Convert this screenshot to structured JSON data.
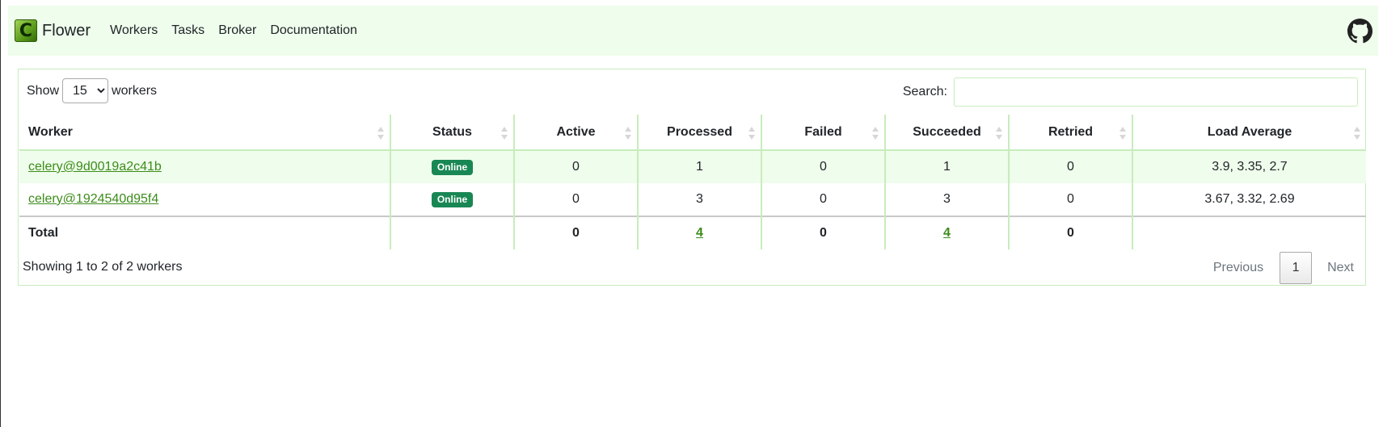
{
  "navbar": {
    "brand": "Flower",
    "links": [
      "Workers",
      "Tasks",
      "Broker",
      "Documentation"
    ]
  },
  "controls": {
    "show_label": "Show",
    "page_size": "15",
    "workers_label": "workers",
    "search_label": "Search:"
  },
  "table": {
    "headers": [
      "Worker",
      "Status",
      "Active",
      "Processed",
      "Failed",
      "Succeeded",
      "Retried",
      "Load Average"
    ],
    "rows": [
      {
        "worker": "celery@9d0019a2c41b",
        "status": "Online",
        "active": "0",
        "processed": "1",
        "failed": "0",
        "succeeded": "1",
        "retried": "0",
        "load": "3.9, 3.35, 2.7"
      },
      {
        "worker": "celery@1924540d95f4",
        "status": "Online",
        "active": "0",
        "processed": "3",
        "failed": "0",
        "succeeded": "3",
        "retried": "0",
        "load": "3.67, 3.32, 2.69"
      }
    ],
    "total": {
      "label": "Total",
      "active": "0",
      "processed": "4",
      "failed": "0",
      "succeeded": "4",
      "retried": "0"
    }
  },
  "footer": {
    "info": "Showing 1 to 2 of 2 workers",
    "previous": "Previous",
    "page": "1",
    "next": "Next"
  },
  "colors": {
    "nav_bg": "#effdec",
    "link": "#3c8c1a",
    "badge": "#198754"
  }
}
